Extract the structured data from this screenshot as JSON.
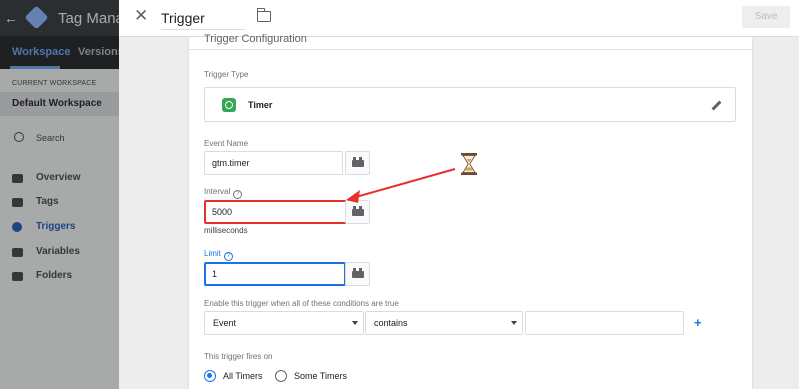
{
  "background_app": {
    "app_title": "Tag Manag",
    "tabs": [
      "Workspace",
      "Versions"
    ],
    "current_workspace_label": "CURRENT WORKSPACE",
    "workspace_name": "Default Workspace",
    "search_placeholder": "Search",
    "nav": [
      "Overview",
      "Tags",
      "Triggers",
      "Variables",
      "Folders"
    ]
  },
  "header": {
    "title": "Trigger",
    "save_label": "Save"
  },
  "card": {
    "title": "Trigger Configuration",
    "trigger_type_label": "Trigger Type",
    "trigger_type_name": "Timer",
    "event_name_label": "Event Name",
    "event_name_value": "gtm.timer",
    "interval_label": "Interval",
    "interval_value": "5000",
    "interval_unit": "milliseconds",
    "limit_label": "Limit",
    "limit_value": "1",
    "conditions_label": "Enable this trigger when all of these conditions are true",
    "condition_variable": "Event",
    "condition_operator": "contains",
    "condition_value": "",
    "add_condition": "+",
    "fires_on_label": "This trigger fires on",
    "fires_on_options": [
      "All Timers",
      "Some Timers"
    ],
    "fires_on_selected": "All Timers"
  },
  "colors": {
    "accent": "#1a73e8",
    "highlight_box": "#e8312a",
    "timer_icon": "#34a853"
  }
}
